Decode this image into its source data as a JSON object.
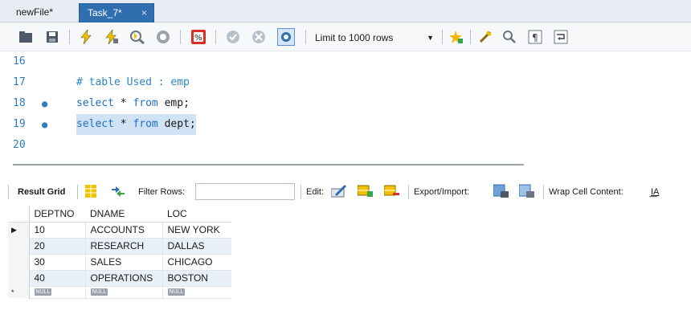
{
  "tabs": [
    {
      "label": "newFile*",
      "active": false
    },
    {
      "label": "Task_7*",
      "active": true,
      "close": "×"
    }
  ],
  "toolbar": {
    "limit_rows": "Limit to 1000 rows",
    "icons": [
      "open-folder-icon",
      "save-icon",
      "execute-icon",
      "execute-statement-icon",
      "explain-icon",
      "stop-icon",
      "toggle-error-icon",
      "commit-icon",
      "rollback-icon",
      "autocommit-icon",
      "add-snippet-icon",
      "beautify-icon",
      "find-icon",
      "invisible-chars-icon",
      "wrap-icon"
    ]
  },
  "editor": {
    "lines": [
      {
        "number": "16",
        "code": ""
      },
      {
        "number": "17",
        "code": "# table Used : emp"
      },
      {
        "number": "18",
        "marker": "●",
        "keyword1": "select",
        "mid": " * ",
        "keyword2": "from",
        "rest": " emp;"
      },
      {
        "number": "19",
        "marker": "●",
        "keyword1": "select",
        "mid": " * ",
        "keyword2": "from",
        "rest": " dept;"
      },
      {
        "number": "20",
        "code": ""
      }
    ]
  },
  "result_toolbar": {
    "result_grid": "Result Grid",
    "filter_rows": "Filter Rows:",
    "filter_value": "",
    "edit": "Edit:",
    "export_import": "Export/Import:",
    "wrap_cell": "Wrap Cell Content:",
    "wrap_icon": "I͟A"
  },
  "grid": {
    "columns": [
      "DEPTNO",
      "DNAME",
      "LOC"
    ],
    "rows": [
      [
        "10",
        "ACCOUNTS",
        "NEW YORK"
      ],
      [
        "20",
        "RESEARCH",
        "DALLAS"
      ],
      [
        "30",
        "SALES",
        "CHICAGO"
      ],
      [
        "40",
        "OPERATIONS",
        "BOSTON"
      ]
    ],
    "null_label": "NULL",
    "current_marker": "▶",
    "new_marker": "*"
  },
  "colors": {
    "tab_active": "#2f6fb0",
    "keyword": "#1f6fc0",
    "selection": "#cfe3f5"
  }
}
